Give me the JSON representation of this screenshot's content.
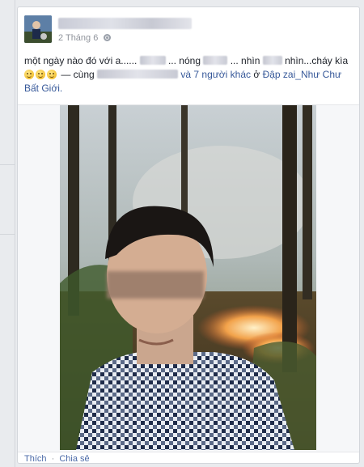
{
  "post": {
    "date": "2 Tháng 6",
    "text_part1": "một ngày nào đó với a......",
    "text_part2": "... nóng",
    "text_part3": "... nhìn",
    "text_part4": "nhìn...cháy kìa",
    "with_label": "— cùng",
    "others": "và 7 người khác",
    "at_label": "ở",
    "place": "Đập zai_Như Chư Bất Giới."
  },
  "actions": {
    "like": "Thích",
    "share": "Chia sẻ",
    "separator": "·"
  },
  "icons": {
    "privacy": "globe-icon",
    "emoji": "grin-emoji-icon"
  },
  "colors": {
    "background": "#e9ebee",
    "card": "#ffffff",
    "link": "#365899",
    "meta": "#90949c"
  }
}
